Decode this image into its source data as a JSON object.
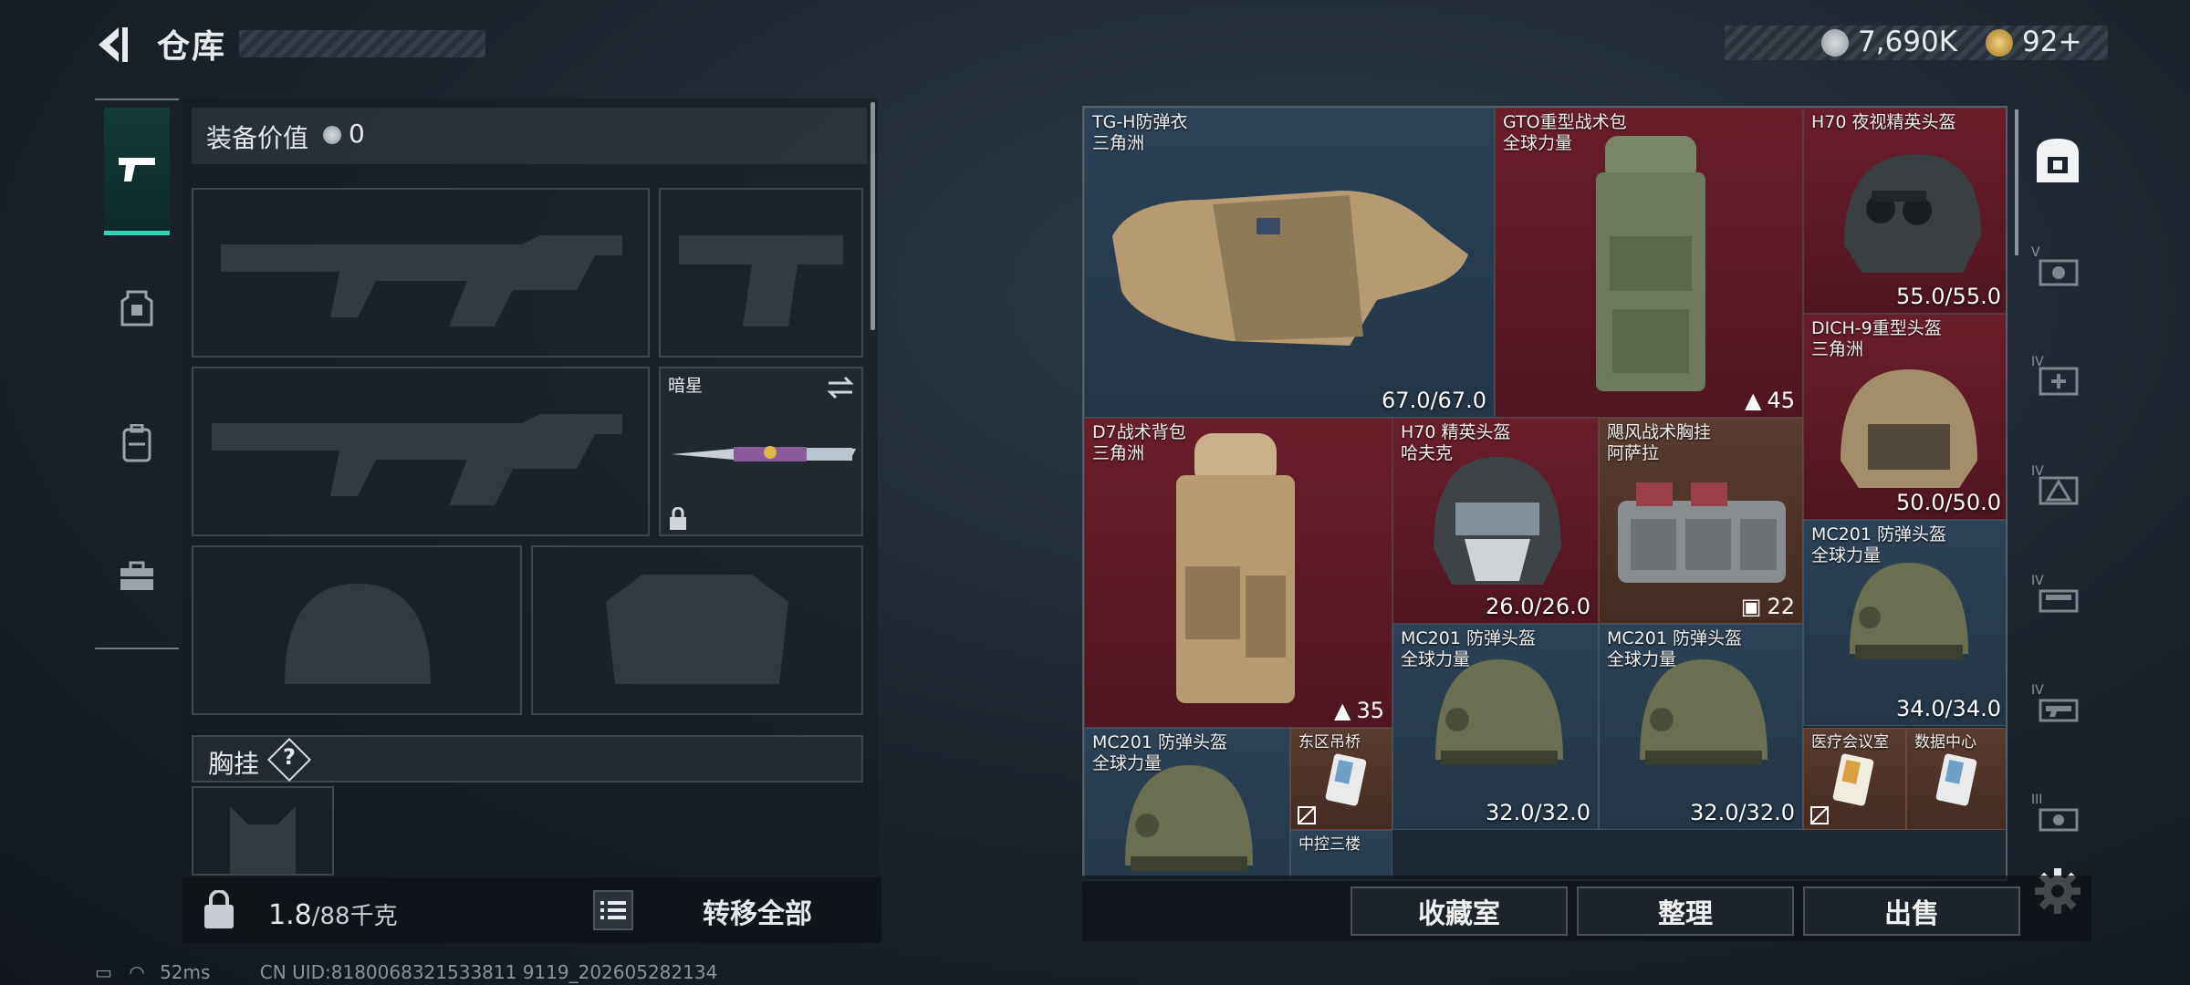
{
  "header": {
    "title": "仓库",
    "currency": "7,690K",
    "tokens": "92+"
  },
  "sidebar": {
    "tabs": [
      "weapon-tab",
      "backpack-tab",
      "locker-tab",
      "case-tab"
    ]
  },
  "loadout": {
    "value_label": "装备价值",
    "value": "0",
    "melee": {
      "name": "暗星"
    },
    "chest_label": "胸挂",
    "chest_help": "?",
    "weight_current": "1.8",
    "weight_max": "/88千克",
    "transfer_all": "转移全部"
  },
  "items": [
    {
      "name": "TG-H防弹衣",
      "sub": "三角洲",
      "stat": "67.0/67.0",
      "color": "blue"
    },
    {
      "name": "GTO重型战术包",
      "sub": "全球力量",
      "stat": "45",
      "color": "red"
    },
    {
      "name": "H70 夜视精英头盔",
      "sub": "",
      "stat": "55.0/55.0",
      "color": "red"
    },
    {
      "name": "DICH-9重型头盔",
      "sub": "三角洲",
      "stat": "50.0/50.0",
      "color": "red"
    },
    {
      "name": "D7战术背包",
      "sub": "三角洲",
      "stat": "35",
      "color": "red"
    },
    {
      "name": "H70 精英头盔",
      "sub": "哈夫克",
      "stat": "26.0/26.0",
      "color": "red"
    },
    {
      "name": "飓风战术胸挂",
      "sub": "阿萨拉",
      "stat": "22",
      "color": "brown"
    },
    {
      "name": "MC201 防弹头盔",
      "sub": "全球力量",
      "stat": "34.0/34.0",
      "color": "blue"
    },
    {
      "name": "MC201 防弹头盔",
      "sub": "全球力量",
      "stat": "32.0/32.0",
      "color": "blue"
    },
    {
      "name": "MC201 防弹头盔",
      "sub": "全球力量",
      "stat": "32.0/32.0",
      "color": "blue"
    },
    {
      "name": "MC201 防弹头盔",
      "sub": "全球力量",
      "stat": "",
      "color": "blue"
    },
    {
      "name": "东区吊桥",
      "sub": "",
      "stat": "",
      "color": "brown"
    },
    {
      "name": "医疗会议室",
      "sub": "",
      "stat": "",
      "color": "brown"
    },
    {
      "name": "数据中心",
      "sub": "",
      "stat": "",
      "color": "brown"
    },
    {
      "name": "中控三楼",
      "sub": "",
      "stat": "",
      "color": "blue"
    }
  ],
  "actions": {
    "collection": "收藏室",
    "sort": "整理",
    "sell": "出售"
  },
  "side_labels": [
    "V",
    "IV",
    "IV",
    "IV",
    "IV",
    "III"
  ],
  "status": {
    "ping": "52ms",
    "uid": "CN UID:8180068321533811 9119_202605282134"
  },
  "colors": {
    "accent": "#2fd6b3",
    "red_cell": "#6a1e2a",
    "blue_cell": "#2c4256",
    "brown_cell": "#5a3c30"
  }
}
